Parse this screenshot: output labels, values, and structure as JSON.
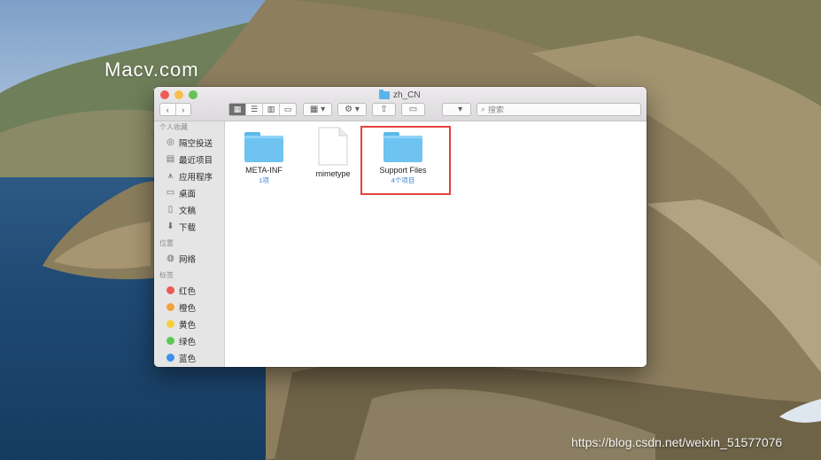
{
  "watermark": {
    "line1": "Macv.com",
    "line2": "v.com"
  },
  "credit": "https://blog.csdn.net/weixin_51577076",
  "window": {
    "title": "zh_CN",
    "search_placeholder": "搜索",
    "toolbar_icons": [
      "back-icon",
      "forward-icon",
      "icon-view-icon",
      "list-view-icon",
      "column-view-icon",
      "gallery-view-icon",
      "group-icon",
      "action-gear-icon",
      "share-icon",
      "tag-icon",
      "sort-icon"
    ]
  },
  "sidebar": {
    "favorites_header": "个人收藏",
    "favorites": [
      {
        "label": "隔空投送",
        "icon": "airdrop-icon"
      },
      {
        "label": "最近项目",
        "icon": "recents-icon"
      },
      {
        "label": "应用程序",
        "icon": "applications-icon"
      },
      {
        "label": "桌面",
        "icon": "desktop-icon"
      },
      {
        "label": "文稿",
        "icon": "documents-icon"
      },
      {
        "label": "下载",
        "icon": "downloads-icon"
      }
    ],
    "locations_header": "位置",
    "locations": [
      {
        "label": "网络",
        "icon": "network-icon"
      }
    ],
    "tags_header": "标签",
    "tags": [
      {
        "label": "红色",
        "color": "#ec5a53"
      },
      {
        "label": "橙色",
        "color": "#f3a23b"
      },
      {
        "label": "黄色",
        "color": "#f5d03b"
      },
      {
        "label": "绿色",
        "color": "#5cc851"
      },
      {
        "label": "蓝色",
        "color": "#3d8ff0"
      }
    ]
  },
  "files": [
    {
      "name": "META-INF",
      "sub": "1项",
      "kind": "folder"
    },
    {
      "name": "mimetype",
      "sub": "",
      "kind": "document"
    },
    {
      "name": "Support Files",
      "sub": "4个项目",
      "kind": "folder",
      "highlighted": true
    }
  ],
  "colors": {
    "highlight": "#e2433a",
    "folder": "#6ec3f1",
    "count_text": "#3c84d6"
  }
}
